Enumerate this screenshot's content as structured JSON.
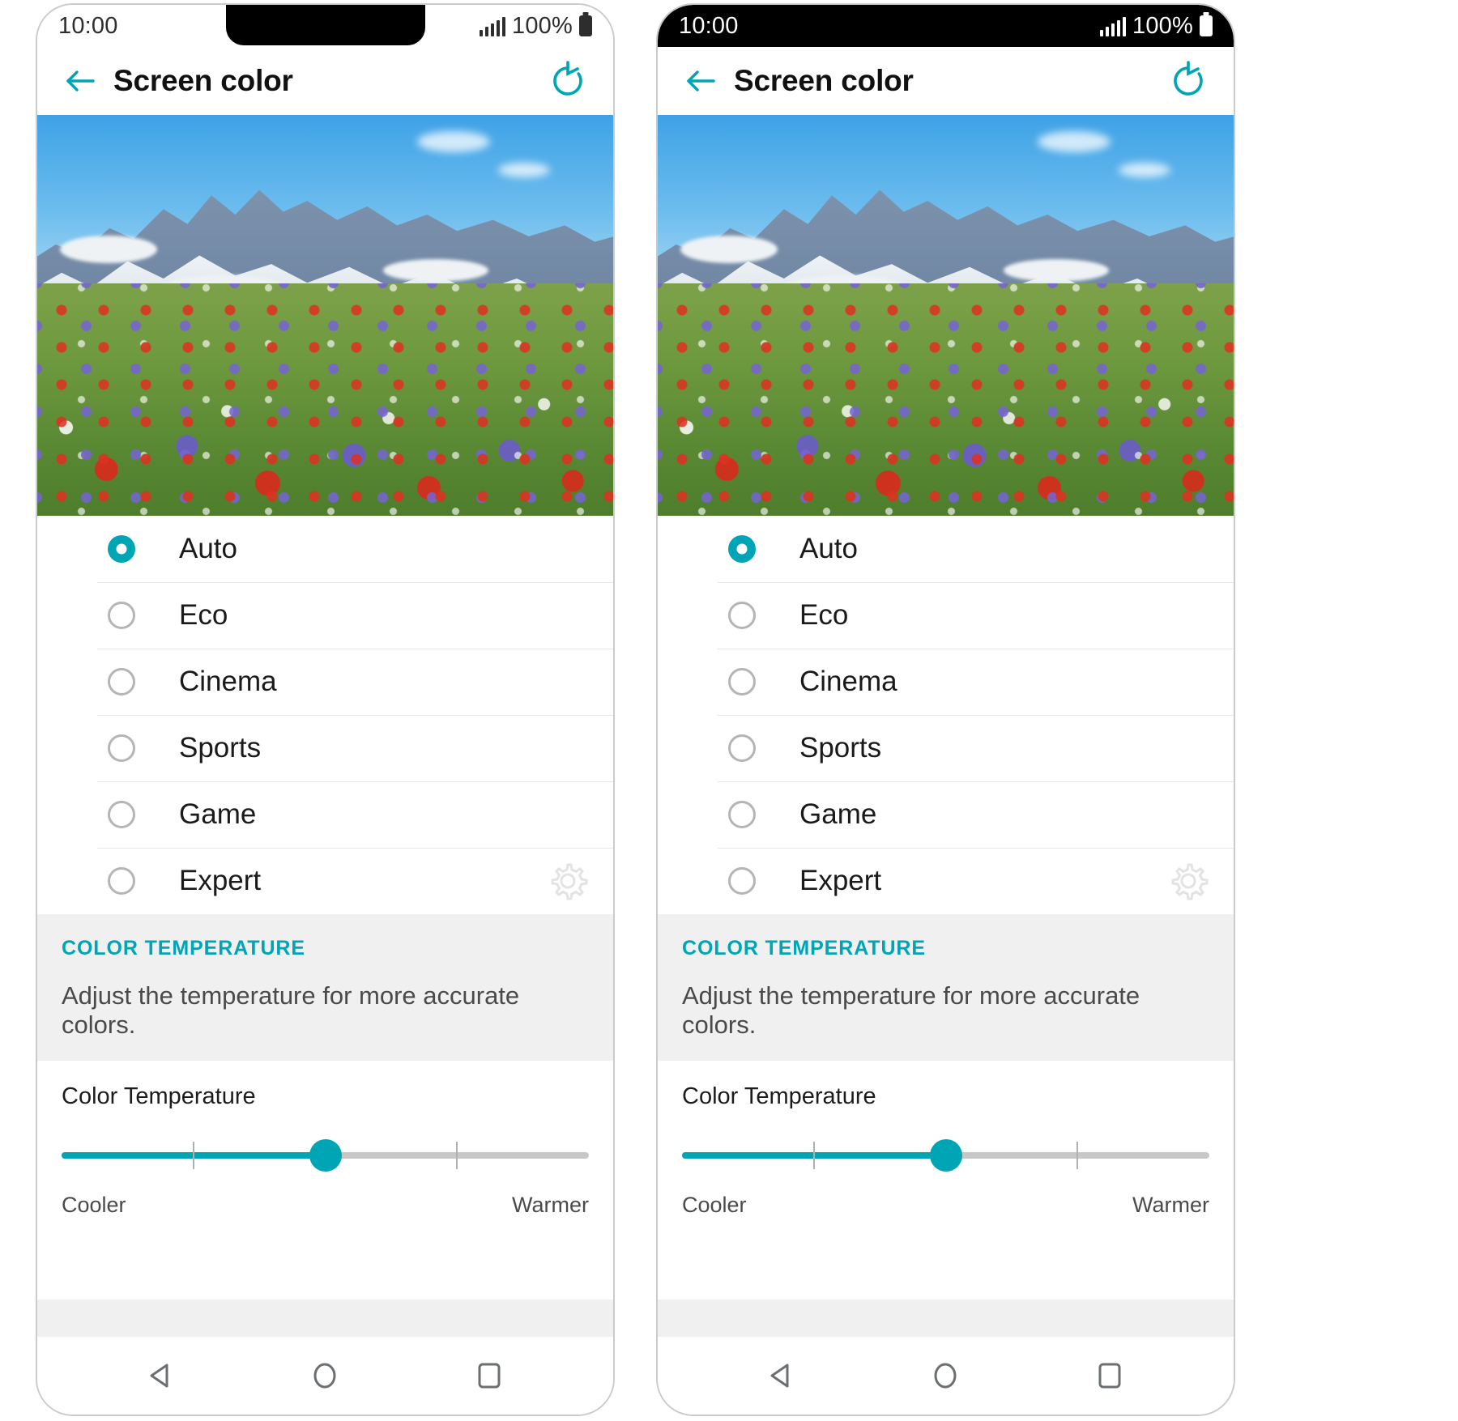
{
  "phones": [
    {
      "id": "left",
      "has_notch": true,
      "status_bar_theme": "light",
      "status": {
        "time": "10:00",
        "battery": "100%",
        "signal_icon": "signal-bars-icon",
        "battery_icon": "battery-full-icon"
      }
    },
    {
      "id": "right",
      "has_notch": false,
      "status_bar_theme": "dark",
      "status": {
        "time": "10:00",
        "battery": "100%",
        "signal_icon": "signal-bars-icon",
        "battery_icon": "battery-full-icon"
      }
    }
  ],
  "appbar": {
    "title": "Screen color",
    "back_icon": "back-arrow-icon",
    "reset_icon": "reset-refresh-icon"
  },
  "preview": {
    "alt": "mountain wildflower meadow preview"
  },
  "options": [
    {
      "label": "Auto",
      "selected": true,
      "has_gear": false
    },
    {
      "label": "Eco",
      "selected": false,
      "has_gear": false
    },
    {
      "label": "Cinema",
      "selected": false,
      "has_gear": false
    },
    {
      "label": "Sports",
      "selected": false,
      "has_gear": false
    },
    {
      "label": "Game",
      "selected": false,
      "has_gear": false
    },
    {
      "label": "Expert",
      "selected": false,
      "has_gear": true
    }
  ],
  "color_temperature": {
    "section_header": "COLOR TEMPERATURE",
    "description": "Adjust the temperature for more accurate colors.",
    "slider_label": "Color Temperature",
    "min_label": "Cooler",
    "max_label": "Warmer",
    "value_percent": 50,
    "tick_percents": [
      25,
      75
    ]
  },
  "navbar": {
    "back": "nav-back-icon",
    "home": "nav-home-icon",
    "recents": "nav-recents-icon"
  },
  "colors": {
    "accent": "#00a5b5",
    "section_bg": "#f0f0f0",
    "divider": "#e6e6e6",
    "text_primary": "#1a1a1a",
    "text_secondary": "#4a4a4a"
  }
}
